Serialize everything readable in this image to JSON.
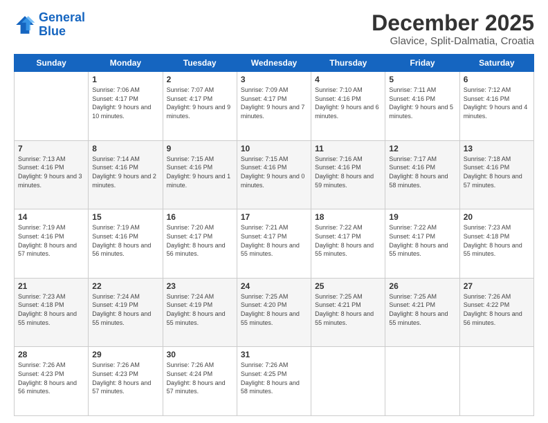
{
  "logo": {
    "line1": "General",
    "line2": "Blue"
  },
  "title": "December 2025",
  "subtitle": "Glavice, Split-Dalmatia, Croatia",
  "weekdays": [
    "Sunday",
    "Monday",
    "Tuesday",
    "Wednesday",
    "Thursday",
    "Friday",
    "Saturday"
  ],
  "weeks": [
    [
      {
        "day": "",
        "sunrise": "",
        "sunset": "",
        "daylight": ""
      },
      {
        "day": "1",
        "sunrise": "Sunrise: 7:06 AM",
        "sunset": "Sunset: 4:17 PM",
        "daylight": "Daylight: 9 hours and 10 minutes."
      },
      {
        "day": "2",
        "sunrise": "Sunrise: 7:07 AM",
        "sunset": "Sunset: 4:17 PM",
        "daylight": "Daylight: 9 hours and 9 minutes."
      },
      {
        "day": "3",
        "sunrise": "Sunrise: 7:09 AM",
        "sunset": "Sunset: 4:17 PM",
        "daylight": "Daylight: 9 hours and 7 minutes."
      },
      {
        "day": "4",
        "sunrise": "Sunrise: 7:10 AM",
        "sunset": "Sunset: 4:16 PM",
        "daylight": "Daylight: 9 hours and 6 minutes."
      },
      {
        "day": "5",
        "sunrise": "Sunrise: 7:11 AM",
        "sunset": "Sunset: 4:16 PM",
        "daylight": "Daylight: 9 hours and 5 minutes."
      },
      {
        "day": "6",
        "sunrise": "Sunrise: 7:12 AM",
        "sunset": "Sunset: 4:16 PM",
        "daylight": "Daylight: 9 hours and 4 minutes."
      }
    ],
    [
      {
        "day": "7",
        "sunrise": "Sunrise: 7:13 AM",
        "sunset": "Sunset: 4:16 PM",
        "daylight": "Daylight: 9 hours and 3 minutes."
      },
      {
        "day": "8",
        "sunrise": "Sunrise: 7:14 AM",
        "sunset": "Sunset: 4:16 PM",
        "daylight": "Daylight: 9 hours and 2 minutes."
      },
      {
        "day": "9",
        "sunrise": "Sunrise: 7:15 AM",
        "sunset": "Sunset: 4:16 PM",
        "daylight": "Daylight: 9 hours and 1 minute."
      },
      {
        "day": "10",
        "sunrise": "Sunrise: 7:15 AM",
        "sunset": "Sunset: 4:16 PM",
        "daylight": "Daylight: 9 hours and 0 minutes."
      },
      {
        "day": "11",
        "sunrise": "Sunrise: 7:16 AM",
        "sunset": "Sunset: 4:16 PM",
        "daylight": "Daylight: 8 hours and 59 minutes."
      },
      {
        "day": "12",
        "sunrise": "Sunrise: 7:17 AM",
        "sunset": "Sunset: 4:16 PM",
        "daylight": "Daylight: 8 hours and 58 minutes."
      },
      {
        "day": "13",
        "sunrise": "Sunrise: 7:18 AM",
        "sunset": "Sunset: 4:16 PM",
        "daylight": "Daylight: 8 hours and 57 minutes."
      }
    ],
    [
      {
        "day": "14",
        "sunrise": "Sunrise: 7:19 AM",
        "sunset": "Sunset: 4:16 PM",
        "daylight": "Daylight: 8 hours and 57 minutes."
      },
      {
        "day": "15",
        "sunrise": "Sunrise: 7:19 AM",
        "sunset": "Sunset: 4:16 PM",
        "daylight": "Daylight: 8 hours and 56 minutes."
      },
      {
        "day": "16",
        "sunrise": "Sunrise: 7:20 AM",
        "sunset": "Sunset: 4:17 PM",
        "daylight": "Daylight: 8 hours and 56 minutes."
      },
      {
        "day": "17",
        "sunrise": "Sunrise: 7:21 AM",
        "sunset": "Sunset: 4:17 PM",
        "daylight": "Daylight: 8 hours and 55 minutes."
      },
      {
        "day": "18",
        "sunrise": "Sunrise: 7:22 AM",
        "sunset": "Sunset: 4:17 PM",
        "daylight": "Daylight: 8 hours and 55 minutes."
      },
      {
        "day": "19",
        "sunrise": "Sunrise: 7:22 AM",
        "sunset": "Sunset: 4:17 PM",
        "daylight": "Daylight: 8 hours and 55 minutes."
      },
      {
        "day": "20",
        "sunrise": "Sunrise: 7:23 AM",
        "sunset": "Sunset: 4:18 PM",
        "daylight": "Daylight: 8 hours and 55 minutes."
      }
    ],
    [
      {
        "day": "21",
        "sunrise": "Sunrise: 7:23 AM",
        "sunset": "Sunset: 4:18 PM",
        "daylight": "Daylight: 8 hours and 55 minutes."
      },
      {
        "day": "22",
        "sunrise": "Sunrise: 7:24 AM",
        "sunset": "Sunset: 4:19 PM",
        "daylight": "Daylight: 8 hours and 55 minutes."
      },
      {
        "day": "23",
        "sunrise": "Sunrise: 7:24 AM",
        "sunset": "Sunset: 4:19 PM",
        "daylight": "Daylight: 8 hours and 55 minutes."
      },
      {
        "day": "24",
        "sunrise": "Sunrise: 7:25 AM",
        "sunset": "Sunset: 4:20 PM",
        "daylight": "Daylight: 8 hours and 55 minutes."
      },
      {
        "day": "25",
        "sunrise": "Sunrise: 7:25 AM",
        "sunset": "Sunset: 4:21 PM",
        "daylight": "Daylight: 8 hours and 55 minutes."
      },
      {
        "day": "26",
        "sunrise": "Sunrise: 7:25 AM",
        "sunset": "Sunset: 4:21 PM",
        "daylight": "Daylight: 8 hours and 55 minutes."
      },
      {
        "day": "27",
        "sunrise": "Sunrise: 7:26 AM",
        "sunset": "Sunset: 4:22 PM",
        "daylight": "Daylight: 8 hours and 56 minutes."
      }
    ],
    [
      {
        "day": "28",
        "sunrise": "Sunrise: 7:26 AM",
        "sunset": "Sunset: 4:23 PM",
        "daylight": "Daylight: 8 hours and 56 minutes."
      },
      {
        "day": "29",
        "sunrise": "Sunrise: 7:26 AM",
        "sunset": "Sunset: 4:23 PM",
        "daylight": "Daylight: 8 hours and 57 minutes."
      },
      {
        "day": "30",
        "sunrise": "Sunrise: 7:26 AM",
        "sunset": "Sunset: 4:24 PM",
        "daylight": "Daylight: 8 hours and 57 minutes."
      },
      {
        "day": "31",
        "sunrise": "Sunrise: 7:26 AM",
        "sunset": "Sunset: 4:25 PM",
        "daylight": "Daylight: 8 hours and 58 minutes."
      },
      {
        "day": "",
        "sunrise": "",
        "sunset": "",
        "daylight": ""
      },
      {
        "day": "",
        "sunrise": "",
        "sunset": "",
        "daylight": ""
      },
      {
        "day": "",
        "sunrise": "",
        "sunset": "",
        "daylight": ""
      }
    ]
  ]
}
